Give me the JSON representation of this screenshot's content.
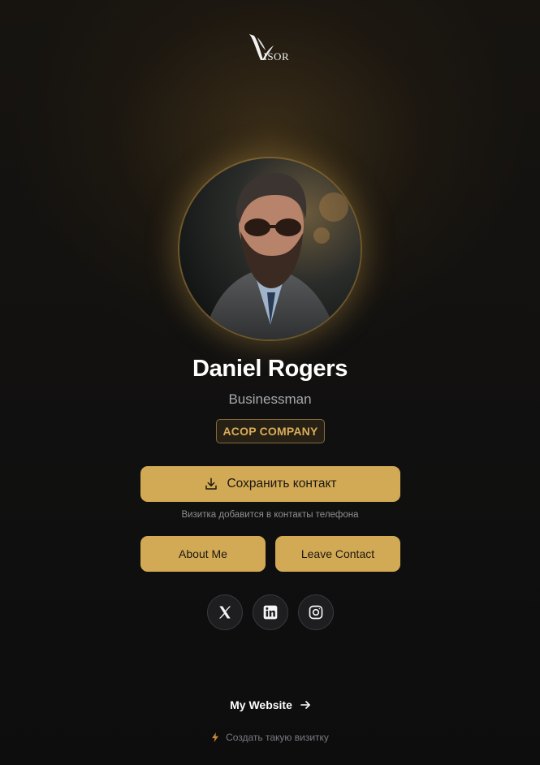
{
  "brand": {
    "logo_text": "ISOR",
    "logo_icon": "wing-v-logo-icon"
  },
  "profile": {
    "name": "Daniel Rogers",
    "role": "Businessman",
    "company": "ACOP COMPANY",
    "photo_icon": "profile-photo"
  },
  "actions": {
    "save_label": "Сохранить контакт",
    "save_icon": "download-icon",
    "save_hint": "Визитка добавится в контакты телефона",
    "about_label": "About Me",
    "leave_label": "Leave Contact"
  },
  "socials": [
    {
      "icon": "x-twitter-icon"
    },
    {
      "icon": "linkedin-icon"
    },
    {
      "icon": "instagram-icon"
    }
  ],
  "footer": {
    "website_label": "My Website",
    "create_label": "Создать такую визитку"
  },
  "colors": {
    "accent": "#d2aa55",
    "background": "#121110",
    "muted_text": "#a8a8ad"
  }
}
